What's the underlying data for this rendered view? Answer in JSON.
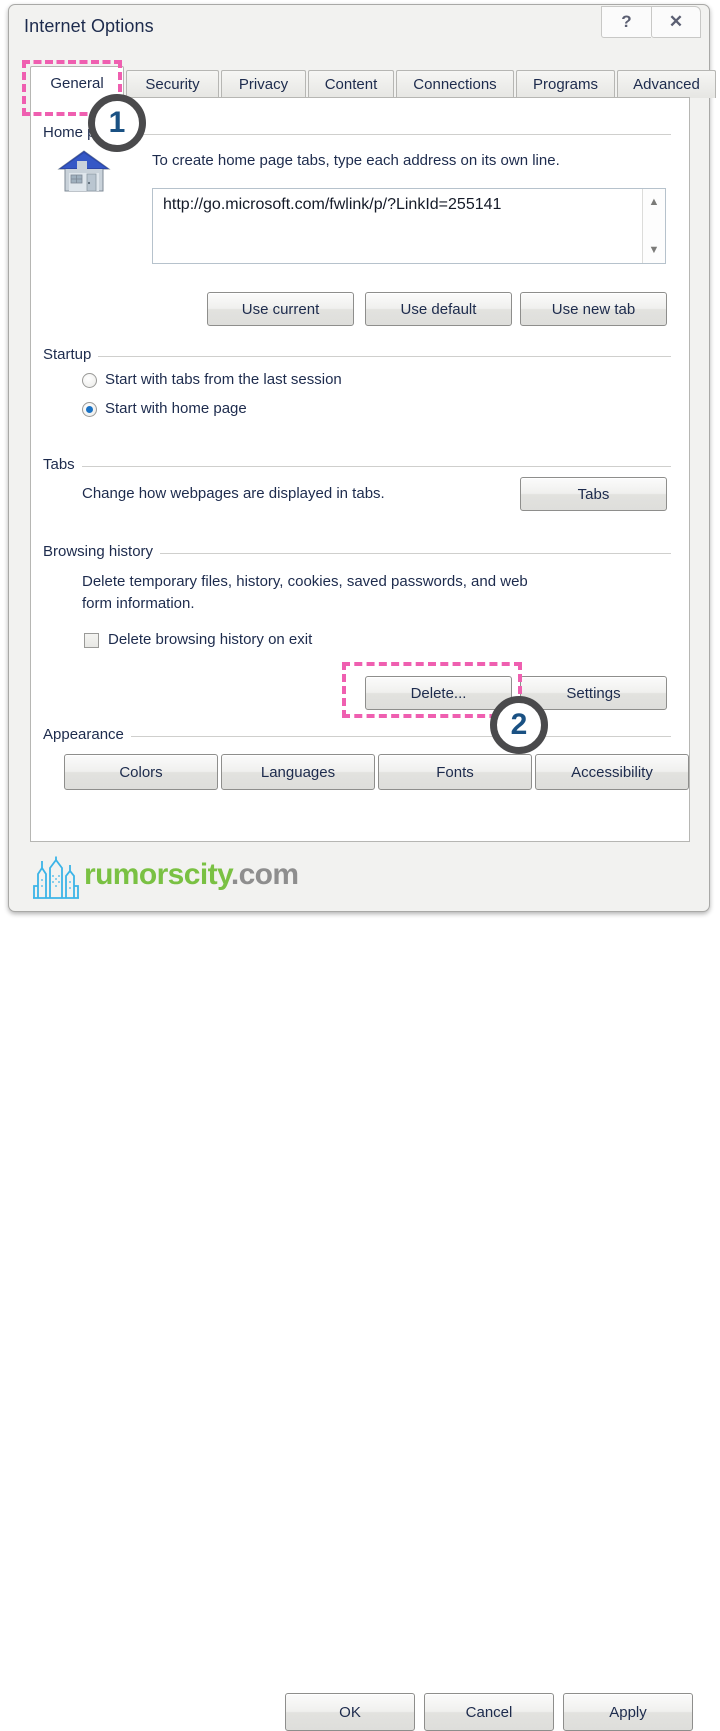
{
  "window": {
    "title": "Internet Options",
    "help_label": "?",
    "close_label": "✕"
  },
  "tabs": [
    {
      "label": "General",
      "active": true
    },
    {
      "label": "Security",
      "active": false
    },
    {
      "label": "Privacy",
      "active": false
    },
    {
      "label": "Content",
      "active": false
    },
    {
      "label": "Connections",
      "active": false
    },
    {
      "label": "Programs",
      "active": false
    },
    {
      "label": "Advanced",
      "active": false
    }
  ],
  "home_page": {
    "group_label": "Home page",
    "icon": "house-icon",
    "instruction": "To create home page tabs, type each address on its own line.",
    "url_value": "http://go.microsoft.com/fwlink/p/?LinkId=255141",
    "url_placeholder": "",
    "scroll_up": "▲",
    "scroll_down": "▼",
    "buttons": [
      {
        "label": "Use current"
      },
      {
        "label": "Use default"
      },
      {
        "label": "Use new tab"
      }
    ]
  },
  "startup": {
    "group_label": "Startup",
    "options": [
      {
        "label": "Start with tabs from the last session",
        "selected": false
      },
      {
        "label": "Start with home page",
        "selected": true
      }
    ]
  },
  "tabs_section": {
    "group_label": "Tabs",
    "description": "Change how webpages are displayed in tabs.",
    "button_label": "Tabs"
  },
  "browsing_history": {
    "group_label": "Browsing history",
    "description_line1": "Delete temporary files, history, cookies, saved passwords, and web",
    "description_line2": "form information.",
    "checkbox_label": "Delete browsing history on exit",
    "checkbox_checked": false,
    "delete_label": "Delete...",
    "settings_label": "Settings"
  },
  "appearance": {
    "group_label": "Appearance",
    "buttons": [
      {
        "label": "Colors"
      },
      {
        "label": "Languages"
      },
      {
        "label": "Fonts"
      },
      {
        "label": "Accessibility"
      }
    ]
  },
  "footer": {
    "buttons": [
      {
        "label": "OK"
      },
      {
        "label": "Cancel"
      },
      {
        "label": "Apply"
      }
    ],
    "watermark_name": "rumorscity",
    "watermark_tld": ".com"
  },
  "annotations": [
    {
      "number": "1",
      "target": "general-tab"
    },
    {
      "number": "2",
      "target": "delete-button"
    }
  ],
  "colors": {
    "highlight": "#ef5fb0",
    "badge_ring": "#4a4a4c",
    "badge_number": "#1a5183",
    "radio_dot": "#1a72c4",
    "watermark_green": "#7ac143",
    "watermark_gray": "#8e8e8e"
  }
}
